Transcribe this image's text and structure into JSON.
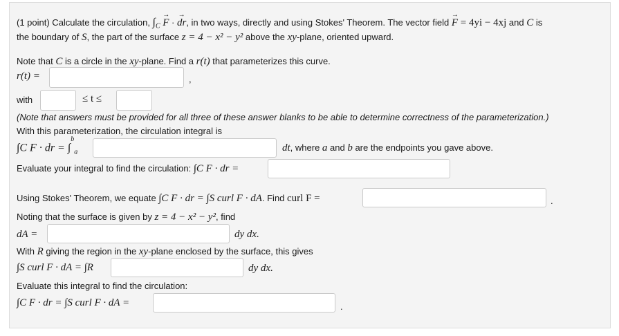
{
  "problem": {
    "intro_pre": "(1 point) Calculate the circulation, ",
    "intro_int": "∫",
    "intro_sub": "C",
    "intro_F": "F",
    "intro_dot": " · ",
    "intro_dr": "dr",
    "intro_mid": ", in two ways, directly and using Stokes' Theorem. The vector field ",
    "field_eq": " = 4yi − 4xj",
    "intro_and": " and ",
    "C": "C",
    "is": " is",
    "line2_pre": "the boundary of ",
    "S": "S",
    "line2_mid": ", the part of the surface ",
    "surface": "z = 4 − x² − y²",
    "line2_post": " above the ",
    "xy": "xy",
    "plane_oriented": "-plane, oriented upward."
  },
  "part1": {
    "note_pre": "Note that ",
    "note_C": "C",
    "note_mid": " is a circle in the ",
    "note_xy": "xy",
    "note_post": "-plane. Find a ",
    "rt": "r(t)",
    "note_end": " that parameterizes this curve.",
    "rt_label": "r(t) =",
    "comma": ",",
    "with_label": "with",
    "ineq": "≤ t ≤",
    "warning": "(Note that answers must be provided for all three of these answer blanks to be able to determine correctness of the parameterization.)",
    "param_text": "With this parameterization, the circulation integral is",
    "int_lhs": "∫C F · dr = ∫",
    "int_a": "a",
    "int_b": "b",
    "dt_text": "dt",
    "dt_post_pre": ", where ",
    "a": "a",
    "and": " and ",
    "b": "b",
    "dt_post_end": " are the endpoints you gave above.",
    "evaluate": "Evaluate your integral to find the circulation: ",
    "eval_int": "∫C F · dr ="
  },
  "part2": {
    "stokes_pre": "Using Stokes' Theorem, we equate ",
    "stokes_eq": "∫C F · dr = ∫S curl F · dA",
    "stokes_find": ". Find ",
    "curl_eq": "curl F =",
    "period": ".",
    "noting_pre": "Noting that the surface is given by ",
    "noting_eq": "z = 4 − x² − y²",
    "noting_post": ", find",
    "dA_label": "dA =",
    "dydx": "dy dx.",
    "with_R_pre": "With ",
    "R": "R",
    "with_R_mid": " giving the region in the ",
    "with_R_xy": "xy",
    "with_R_post": "-plane enclosed by the surface, this gives",
    "surf_int": "∫S curl F · dA = ∫R",
    "dydx2": "dy dx.",
    "evaluate2": "Evaluate this integral to find the circulation:",
    "final_int": "∫C F · dr = ∫S curl F · dA =",
    "final_period": "."
  }
}
